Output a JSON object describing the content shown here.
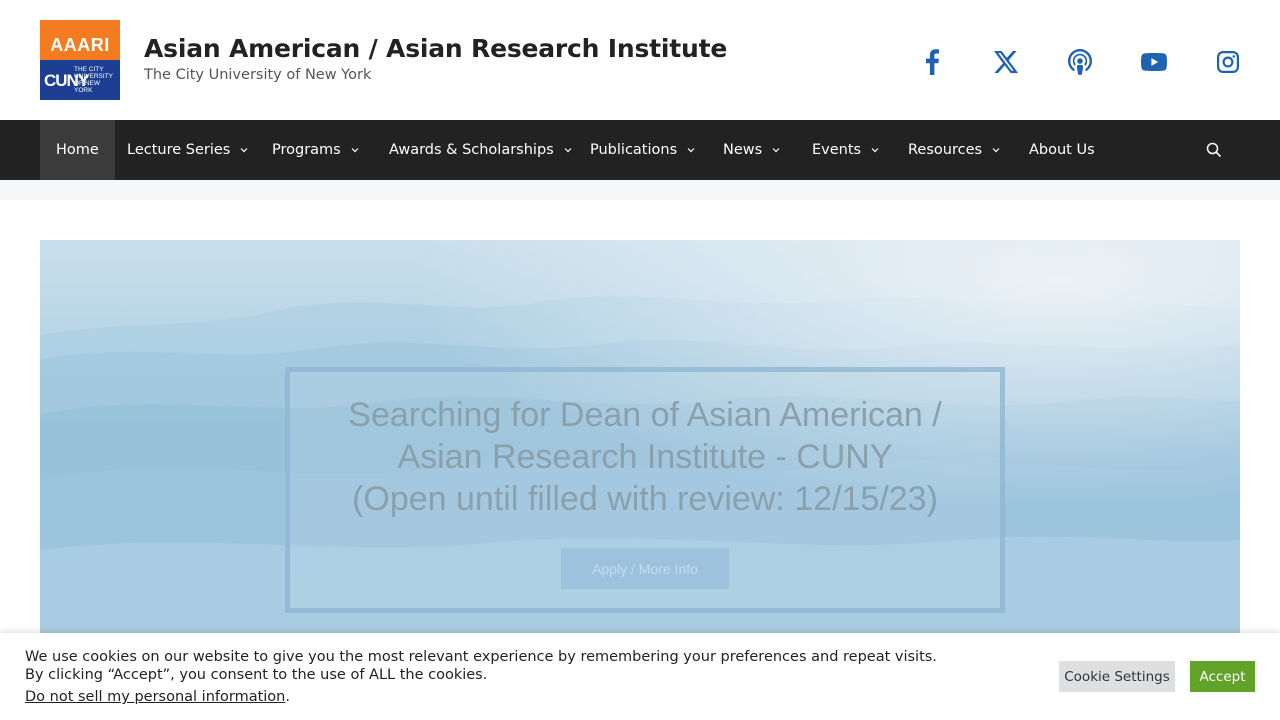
{
  "header": {
    "logo_top": "AAARI",
    "logo_cuny": "CUNY",
    "logo_sub": "THE CITY UNIVERSITY OF NEW YORK",
    "title": "Asian American / Asian Research Institute",
    "tagline": "The City University of New York",
    "social": [
      {
        "icon": "facebook-icon"
      },
      {
        "icon": "x-twitter-icon"
      },
      {
        "icon": "podcast-icon"
      },
      {
        "icon": "youtube-icon"
      },
      {
        "icon": "instagram-icon"
      }
    ]
  },
  "nav": {
    "items": [
      {
        "label": "Home",
        "active": true,
        "dropdown": false
      },
      {
        "label": "Lecture Series",
        "dropdown": true
      },
      {
        "label": "Programs",
        "dropdown": true
      },
      {
        "label": "Awards & Scholarships",
        "dropdown": true
      },
      {
        "label": "Publications",
        "dropdown": true
      },
      {
        "label": "News",
        "dropdown": true
      },
      {
        "label": "Events",
        "dropdown": true
      },
      {
        "label": "Resources",
        "dropdown": true
      },
      {
        "label": "About Us",
        "dropdown": false
      }
    ],
    "search_icon": "search-icon"
  },
  "hero": {
    "line1": "Searching for Dean of Asian American /",
    "line2": "Asian Research Institute - CUNY",
    "line3": "(Open until filled with review: 12/15/23)",
    "button": "Apply / More Info"
  },
  "cookie": {
    "line1": "We use cookies on our website to give you the most relevant experience by remembering your preferences and repeat visits.",
    "line2": "By clicking “Accept”, you consent to the use of ALL the cookies.",
    "link": "Do not sell my personal information",
    "link_suffix": ".",
    "settings_button": "Cookie Settings",
    "accept_button": "Accept"
  },
  "colors": {
    "brand_orange": "#f47b20",
    "brand_blue": "#1c3f94",
    "social_blue": "#1e63b0",
    "nav_bg": "#222222",
    "accept_green": "#61a229"
  }
}
